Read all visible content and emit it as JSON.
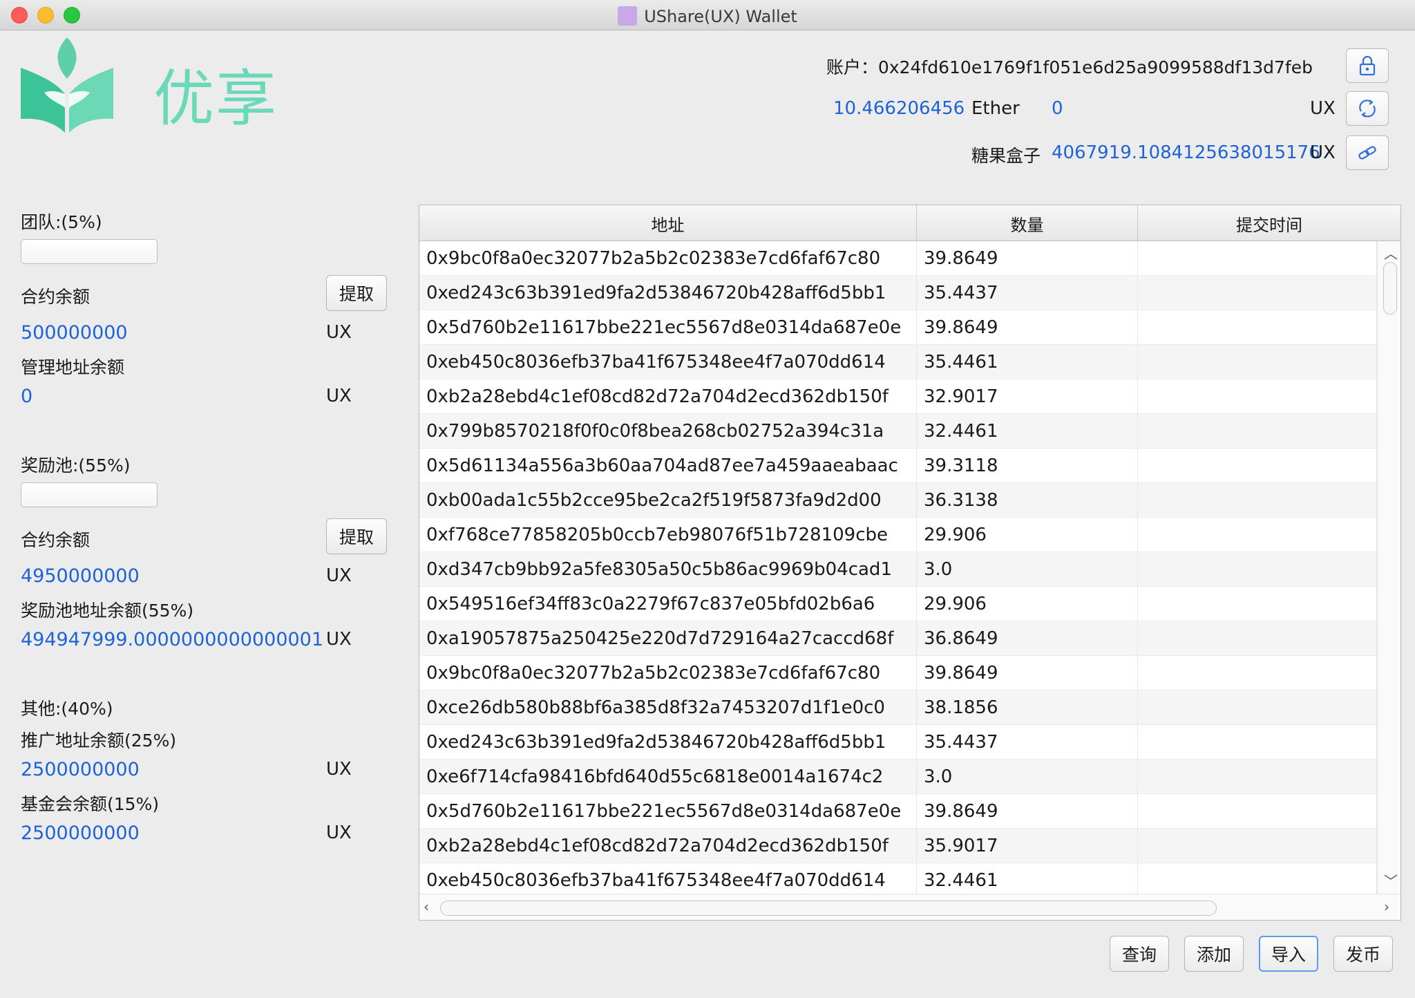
{
  "window": {
    "title": "UShare(UX) Wallet"
  },
  "logo": {
    "text": "优享"
  },
  "header": {
    "account_label": "账户：",
    "account_address": "0x24fd610e1769f1f051e6d25a9099588df13d7feb",
    "ether_value": "10.466206456",
    "ether_label": "Ether",
    "ux_balance": "0",
    "ux_label": "UX",
    "candy_label": "糖果盒子",
    "candy_value": "4067919.1084125638015176",
    "candy_unit": "UX",
    "icons": [
      "lock-icon",
      "refresh-icon",
      "link-icon"
    ]
  },
  "team": {
    "title": "团队:(5%)",
    "progress": 0,
    "contract_label": "合约余额",
    "withdraw_label": "提取",
    "contract_value": "500000000",
    "contract_unit": "UX",
    "admin_label": "管理地址余额",
    "admin_value": "0",
    "admin_unit": "UX"
  },
  "reward": {
    "title": "奖励池:(55%)",
    "progress": 0,
    "contract_label": "合约余额",
    "withdraw_label": "提取",
    "contract_value": "4950000000",
    "contract_unit": "UX",
    "pool_label": "奖励池地址余额(55%)",
    "pool_value": "494947999.0000000000000001",
    "pool_unit": "UX"
  },
  "other": {
    "title": "其他:(40%)",
    "promo_label": "推广地址余额(25%)",
    "promo_value": "2500000000",
    "promo_unit": "UX",
    "fund_label": "基金会余额(15%)",
    "fund_value": "2500000000",
    "fund_unit": "UX"
  },
  "table": {
    "columns": [
      "地址",
      "数量",
      "提交时间"
    ],
    "rows": [
      [
        "0x9bc0f8a0ec32077b2a5b2c02383e7cd6faf67c80",
        "39.8649",
        ""
      ],
      [
        "0xed243c63b391ed9fa2d53846720b428aff6d5bb1",
        "35.4437",
        ""
      ],
      [
        "0x5d760b2e11617bbe221ec5567d8e0314da687e0e",
        "39.8649",
        ""
      ],
      [
        "0xeb450c8036efb37ba41f675348ee4f7a070dd614",
        "35.4461",
        ""
      ],
      [
        "0xb2a28ebd4c1ef08cd82d72a704d2ecd362db150f",
        "32.9017",
        ""
      ],
      [
        "0x799b8570218f0f0c0f8bea268cb02752a394c31a",
        "32.4461",
        ""
      ],
      [
        "0x5d61134a556a3b60aa704ad87ee7a459aaeabaac",
        "39.3118",
        ""
      ],
      [
        "0xb00ada1c55b2cce95be2ca2f519f5873fa9d2d00",
        "36.3138",
        ""
      ],
      [
        "0xf768ce77858205b0ccb7eb98076f51b728109cbe",
        "29.906",
        ""
      ],
      [
        "0xd347cb9bb92a5fe8305a50c5b86ac9969b04cad1",
        "3.0",
        ""
      ],
      [
        "0x549516ef34ff83c0a2279f67c837e05bfd02b6a6",
        "29.906",
        ""
      ],
      [
        "0xa19057875a250425e220d7d729164a27caccd68f",
        "36.8649",
        ""
      ],
      [
        "0x9bc0f8a0ec32077b2a5b2c02383e7cd6faf67c80",
        "39.8649",
        ""
      ],
      [
        "0xce26db580b88bf6a385d8f32a7453207d1f1e0c0",
        "38.1856",
        ""
      ],
      [
        "0xed243c63b391ed9fa2d53846720b428aff6d5bb1",
        "35.4437",
        ""
      ],
      [
        "0xe6f714cfa98416bfd640d55c6818e0014a1674c2",
        "3.0",
        ""
      ],
      [
        "0x5d760b2e11617bbe221ec5567d8e0314da687e0e",
        "39.8649",
        ""
      ],
      [
        "0xb2a28ebd4c1ef08cd82d72a704d2ecd362db150f",
        "35.9017",
        ""
      ],
      [
        "0xeb450c8036efb37ba41f675348ee4f7a070dd614",
        "32.4461",
        ""
      ]
    ]
  },
  "buttons": {
    "query": "查询",
    "add": "添加",
    "import": "导入",
    "issue": "发币"
  },
  "colors": {
    "accent_blue": "#1e63d6",
    "logo_green": "#69d9b7"
  }
}
